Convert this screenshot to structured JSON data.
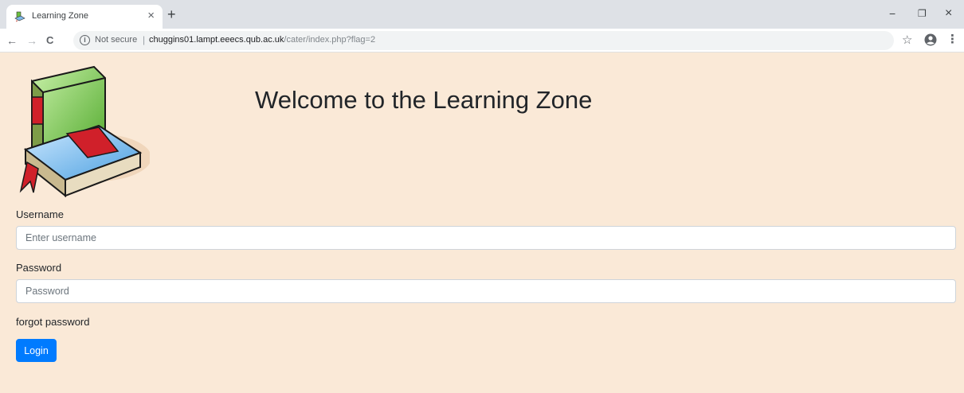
{
  "browser": {
    "tab_title": "Learning Zone",
    "tab_close_glyph": "×",
    "new_tab_glyph": "+",
    "minimize_glyph": "−",
    "restore_glyph": "❐",
    "close_glyph": "×",
    "back_glyph": "←",
    "forward_glyph": "→",
    "reload_glyph": "C",
    "security_label": "Not secure",
    "separator": "|",
    "url_host": "chuggins01.lampt.eeecs.qub.ac.uk",
    "url_path": "/cater/index.php?flag=2",
    "star_glyph": "☆",
    "menu_glyph": "⋮",
    "icons": [
      "book-favicon-icon",
      "info-icon",
      "star-icon",
      "profile-icon",
      "menu-icon"
    ]
  },
  "page": {
    "title": "Welcome to the Learning Zone",
    "background": "#fae9d7",
    "username_label": "Username",
    "username_placeholder": "Enter username",
    "password_label": "Password",
    "password_placeholder": "Password",
    "forgot_link": "forgot password",
    "login_button": "Login",
    "accent": "#007bff"
  }
}
